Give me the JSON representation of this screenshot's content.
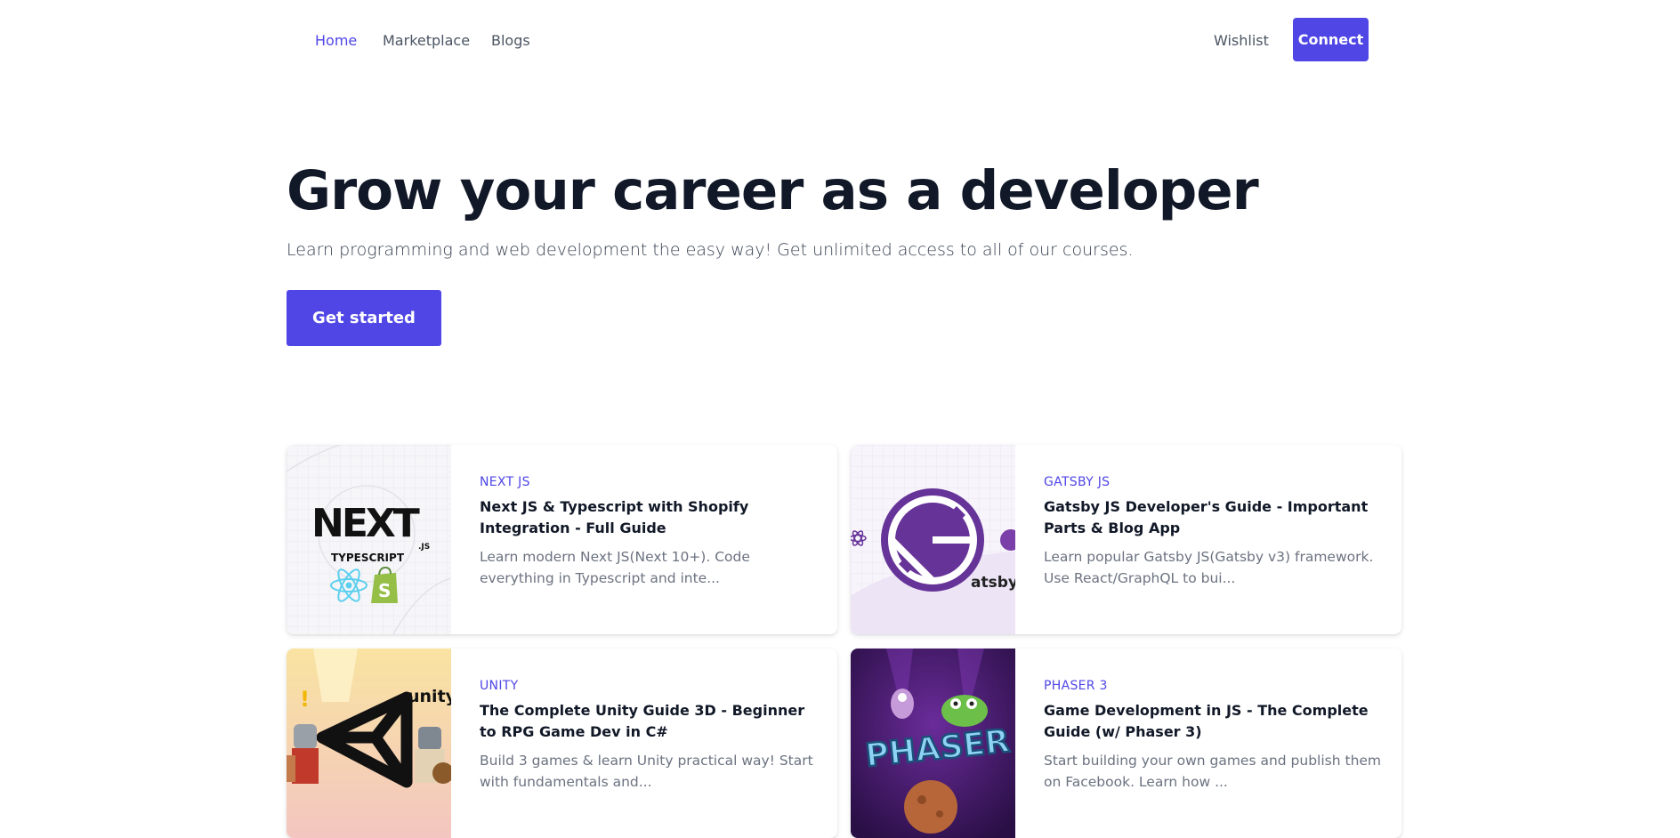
{
  "nav": {
    "links": [
      {
        "label": "Home",
        "active": true
      },
      {
        "label": "Marketplace",
        "active": false
      },
      {
        "label": "Blogs",
        "active": false
      }
    ],
    "wishlist": "Wishlist",
    "connect": "Connect"
  },
  "hero": {
    "title": "Grow your career as a developer",
    "subtitle": "Learn programming and web development the easy way! Get unlimited access to all of our courses.",
    "cta": "Get started"
  },
  "courses": [
    {
      "category": "Next JS",
      "title": "Next JS & Typescript with Shopify Integration - Full Guide",
      "description": "Learn modern Next JS(Next 10+). Code everything in Typescript and inte...",
      "thumb_text": {
        "main": "NEXT",
        "suffix": ".JS",
        "sub": "TYPESCRIPT",
        "badge": "S"
      }
    },
    {
      "category": "Gatsby JS",
      "title": "Gatsby JS Developer's Guide - Important Parts & Blog App",
      "description": "Learn popular Gatsby JS(Gatsby v3) framework. Use React/GraphQL to bui...",
      "thumb_text": {
        "main": "atsby"
      }
    },
    {
      "category": "Unity",
      "title": "The Complete Unity Guide 3D - Beginner to RPG Game Dev in C#",
      "description": "Build 3 games & learn Unity practical way! Start with fundamentals and...",
      "thumb_text": {
        "main": "unity",
        "alert": "!"
      }
    },
    {
      "category": "Phaser 3",
      "title": "Game Development in JS - The Complete Guide (w/ Phaser 3)",
      "description": "Start building your own games and publish them on Facebook. Learn how ...",
      "thumb_text": {
        "main": "PHASER"
      }
    }
  ],
  "colors": {
    "accent": "#4f46e5",
    "text_dark": "#111827",
    "text_muted": "#6b7280",
    "nav_text": "#4b5563"
  }
}
